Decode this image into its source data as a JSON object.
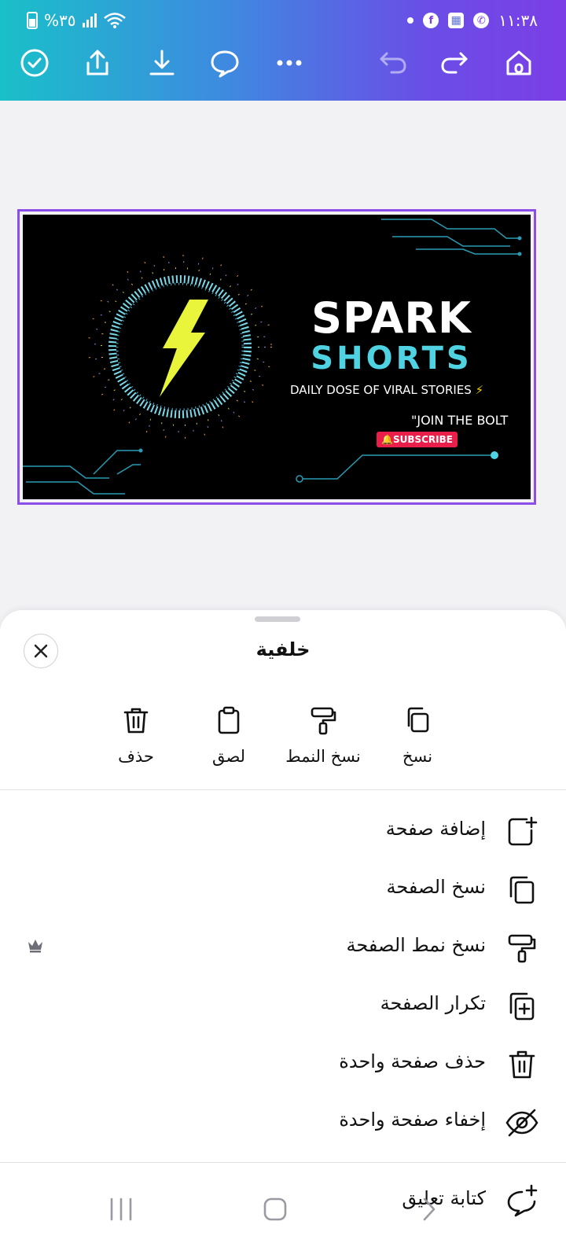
{
  "status_bar": {
    "time": "١١:٣٨",
    "battery_text": "%٣٥"
  },
  "toolbar": {
    "icons": [
      "check-circle-icon",
      "share-icon",
      "download-icon",
      "comment-icon",
      "more-icon",
      "undo-icon",
      "redo-icon",
      "home-icon"
    ]
  },
  "design": {
    "title_line1": "SPARK",
    "title_line2": "SHORTS",
    "tagline": "DAILY DOSE OF VIRAL STORIES",
    "tagline_emoji": "⚡",
    "join_text": "\"JOIN THE BOLT",
    "subscribe_label": "🔔SUBSCRIBE",
    "colors": {
      "frame": "#8b4ee8",
      "accent": "#4fd3e3",
      "bolt": "#e8f53a",
      "subscribe": "#e91e4b"
    }
  },
  "sheet": {
    "title": "خلفية",
    "quick_actions": [
      {
        "label": "نسخ",
        "icon": "copy-icon"
      },
      {
        "label": "نسخ النمط",
        "icon": "paint-roller-icon"
      },
      {
        "label": "لصق",
        "icon": "clipboard-icon"
      },
      {
        "label": "حذف",
        "icon": "trash-icon"
      }
    ],
    "menu": [
      {
        "label": "إضافة صفحة",
        "icon": "add-page-icon"
      },
      {
        "label": "نسخ الصفحة",
        "icon": "copy-page-icon"
      },
      {
        "label": "نسخ نمط الصفحة",
        "icon": "paint-roller-icon",
        "pro": true
      },
      {
        "label": "تكرار الصفحة",
        "icon": "duplicate-page-icon"
      },
      {
        "label": "حذف صفحة واحدة",
        "icon": "trash-icon"
      },
      {
        "label": "إخفاء صفحة واحدة",
        "icon": "eye-off-icon"
      },
      {
        "label": "كتابة تعليق",
        "icon": "add-comment-icon"
      }
    ]
  }
}
